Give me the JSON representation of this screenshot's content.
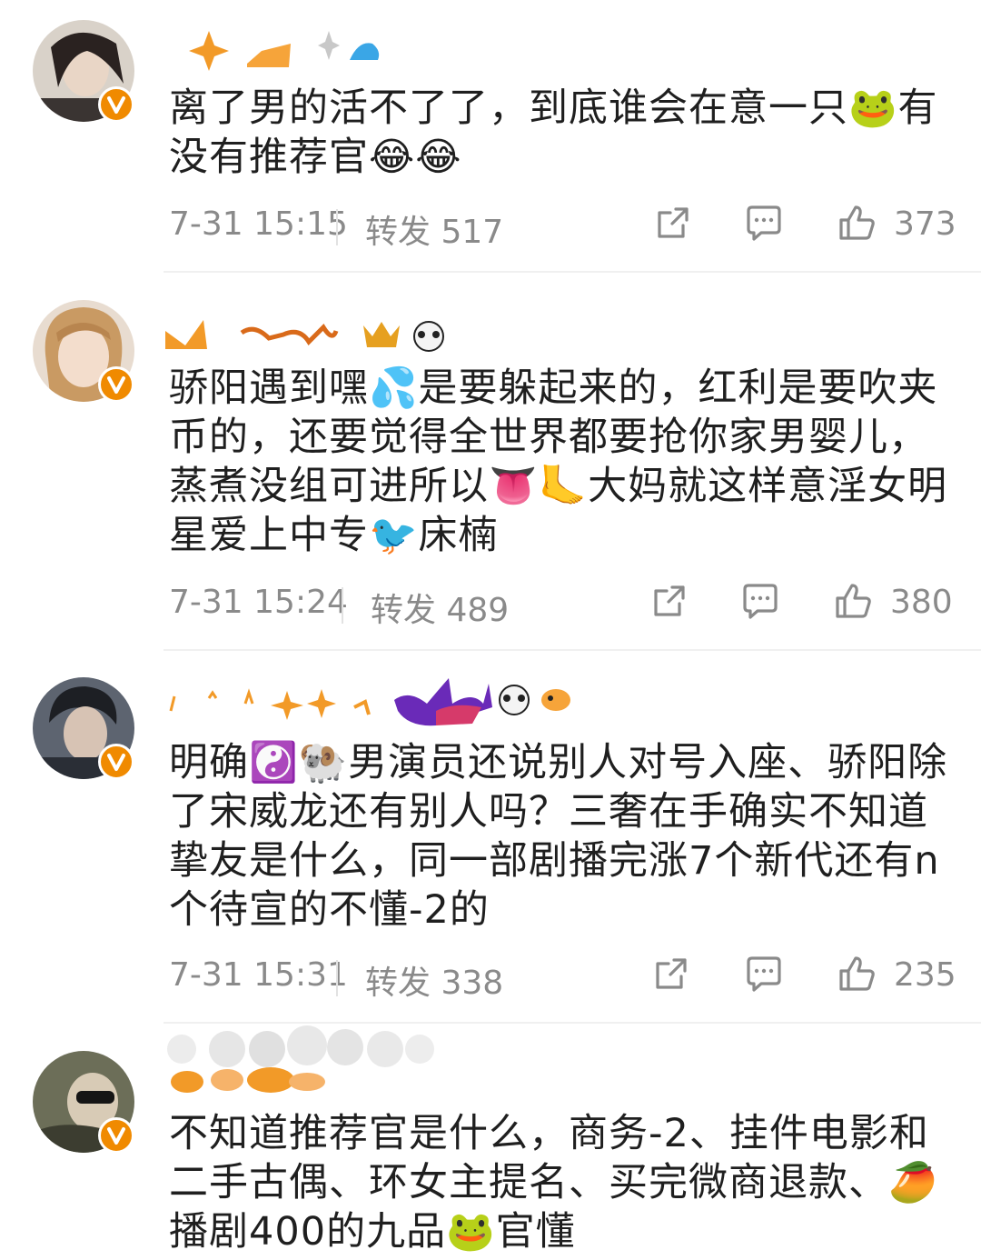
{
  "comments": [
    {
      "text": "离了男的活不了了，到底谁会在意一只🐸有没有推荐官😂😂",
      "time": "7-31 15:15",
      "repost": "转发 517",
      "likes": "373"
    },
    {
      "text": "骄阳遇到嘿💦是要躲起来的，红利是要吹夹币的，还要觉得全世界都要抢你家男婴儿，蒸煮没组可进所以👅🦶大妈就这样意淫女明星爱上中专🐦床楠",
      "time": "7-31 15:24",
      "repost": "转发 489",
      "likes": "380"
    },
    {
      "text": "明确☯️🐏男演员还说别人对号入座、骄阳除了宋威龙还有别人吗？三奢在手确实不知道挚友是什么，同一部剧播完涨7个新代还有n个待宣的不懂-2的",
      "time": "7-31 15:31",
      "repost": "转发 338",
      "likes": "235"
    },
    {
      "text": "不知道推荐官是什么，商务-2、挂件电影和二手古偶、环女主提名、买完微商退款、🥭播剧400的九品🐸官懂"
    }
  ],
  "icons": {
    "share": "share-icon",
    "comment": "comment-icon",
    "like": "thumbs-up-icon",
    "verified": "verified-v-badge"
  },
  "colors": {
    "accent_orange": "#f08a00",
    "meta_gray": "#8a8a8a",
    "divider": "#f0f0f0"
  }
}
